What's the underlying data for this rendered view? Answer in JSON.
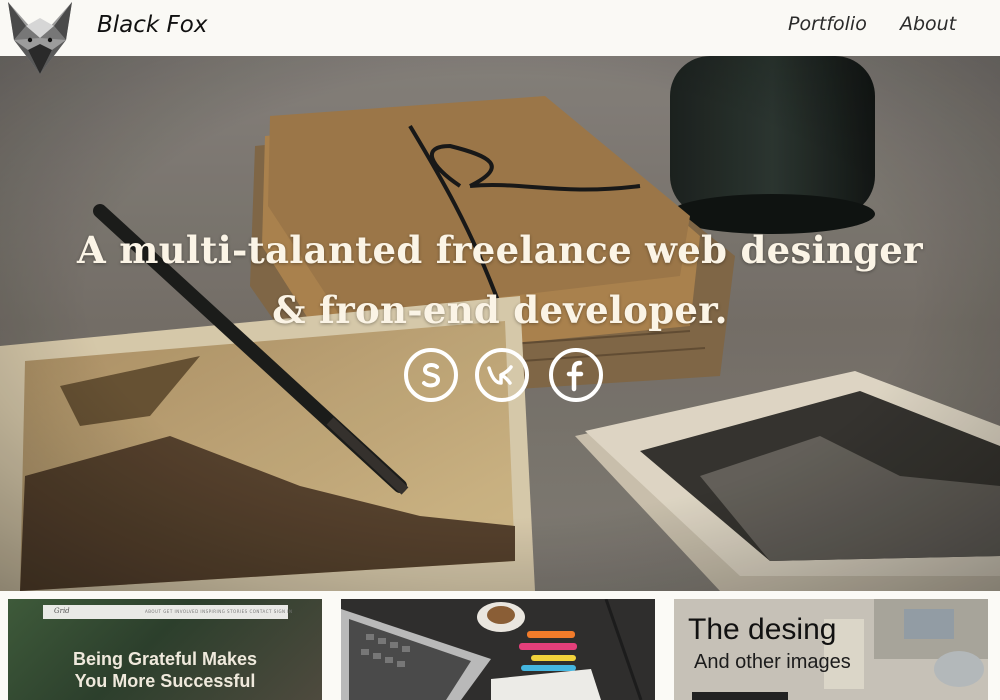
{
  "header": {
    "brand": "Black Fox",
    "logo_icon": "fox-logo-icon",
    "nav": [
      {
        "label": "Portfolio"
      },
      {
        "label": "About"
      }
    ]
  },
  "hero": {
    "line1": "A multi-talanted freelance web desinger",
    "line2": "& fron-end developer.",
    "social": [
      {
        "icon": "skype-icon",
        "symbol": "S"
      },
      {
        "icon": "vk-icon",
        "symbol": "vk"
      },
      {
        "icon": "facebook-icon",
        "symbol": "f"
      }
    ]
  },
  "portfolio": {
    "cards": [
      {
        "brand": "Grid",
        "menu": "ABOUT   GET INVOLVED   INSPIRING STORIES   CONTACT   SIGN IN",
        "title_line1": "Being Grateful Makes",
        "title_line2": "You More Successful"
      },
      {
        "image": "laptop-desk-image"
      },
      {
        "title": "The desing",
        "subtitle": "And other images"
      }
    ]
  },
  "colors": {
    "header_bg": "#faf9f5",
    "hero_text": "#fbf4e6",
    "nav_text": "#2b2b2b"
  }
}
